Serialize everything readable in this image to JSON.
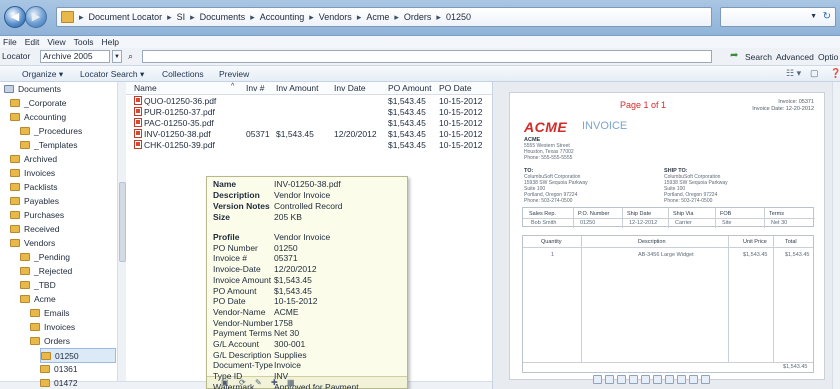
{
  "breadcrumbs": [
    "Document Locator",
    "SI",
    "Documents",
    "Accounting",
    "Vendors",
    "Acme",
    "Orders",
    "01250"
  ],
  "menu": [
    "File",
    "Edit",
    "View",
    "Tools",
    "Help"
  ],
  "locator": {
    "label": "Locator",
    "value": "Archive 2005",
    "search_label": "Search",
    "advanced_label": "Advanced",
    "options_label": "Optio"
  },
  "commands": {
    "organize": "Organize",
    "locator_search": "Locator Search",
    "collections": "Collections",
    "preview": "Preview"
  },
  "tree": [
    {
      "label": "Documents",
      "indent": 0,
      "kind": "docs"
    },
    {
      "label": "_Corporate",
      "indent": 1
    },
    {
      "label": "Accounting",
      "indent": 1
    },
    {
      "label": "_Procedures",
      "indent": 2
    },
    {
      "label": "_Templates",
      "indent": 2
    },
    {
      "label": "Archived",
      "indent": 1
    },
    {
      "label": "Invoices",
      "indent": 1
    },
    {
      "label": "Packlists",
      "indent": 1
    },
    {
      "label": "Payables",
      "indent": 1
    },
    {
      "label": "Purchases",
      "indent": 1
    },
    {
      "label": "Received",
      "indent": 1
    },
    {
      "label": "Vendors",
      "indent": 1
    },
    {
      "label": "_Pending",
      "indent": 2
    },
    {
      "label": "_Rejected",
      "indent": 2
    },
    {
      "label": "_TBD",
      "indent": 2
    },
    {
      "label": "Acme",
      "indent": 2
    },
    {
      "label": "Emails",
      "indent": 3
    },
    {
      "label": "Invoices",
      "indent": 3
    },
    {
      "label": "Orders",
      "indent": 3
    },
    {
      "label": "01250",
      "indent": 4,
      "selected": true
    },
    {
      "label": "01361",
      "indent": 4
    },
    {
      "label": "01472",
      "indent": 4
    }
  ],
  "columns": [
    "Name",
    "Inv #",
    "Inv Amount",
    "Inv Date",
    "PO Amount",
    "PO Date"
  ],
  "files": [
    {
      "name": "QUO-01250-36.pdf",
      "inv_no": "",
      "inv_amount": "",
      "inv_date": "",
      "po_amount": "$1,543.45",
      "po_date": "10-15-2012"
    },
    {
      "name": "PUR-01250-37.pdf",
      "inv_no": "",
      "inv_amount": "",
      "inv_date": "",
      "po_amount": "$1,543.45",
      "po_date": "10-15-2012"
    },
    {
      "name": "PAC-01250-35.pdf",
      "inv_no": "",
      "inv_amount": "",
      "inv_date": "",
      "po_amount": "$1,543.45",
      "po_date": "10-15-2012"
    },
    {
      "name": "INV-01250-38.pdf",
      "inv_no": "05371",
      "inv_amount": "$1,543.45",
      "inv_date": "12/20/2012",
      "po_amount": "$1,543.45",
      "po_date": "10-15-2012"
    },
    {
      "name": "CHK-01250-39.pdf",
      "inv_no": "",
      "inv_amount": "",
      "inv_date": "",
      "po_amount": "$1,543.45",
      "po_date": "10-15-2012"
    }
  ],
  "tooltip": {
    "top": [
      {
        "k": "Name",
        "v": "INV-01250-38.pdf"
      },
      {
        "k": "Description",
        "v": "Vendor Invoice"
      },
      {
        "k": "Version Notes",
        "v": "Controlled Record"
      },
      {
        "k": "Size",
        "v": "205 KB"
      }
    ],
    "profile": [
      {
        "k": "Profile",
        "v": "Vendor Invoice",
        "bold": true
      },
      {
        "k": "PO Number",
        "v": "01250"
      },
      {
        "k": "Invoice #",
        "v": "05371"
      },
      {
        "k": "Invoice-Date",
        "v": "12/20/2012"
      },
      {
        "k": "Invoice Amount",
        "v": "$1,543.45"
      },
      {
        "k": "PO Amount",
        "v": "$1,543.45"
      },
      {
        "k": "PO Date",
        "v": "10-15-2012"
      },
      {
        "k": "Vendor-Name",
        "v": "ACME"
      },
      {
        "k": "Vendor-Number",
        "v": "1758"
      },
      {
        "k": "Payment Terms",
        "v": "Net 30"
      },
      {
        "k": "G/L Account",
        "v": "300-001"
      },
      {
        "k": "G/L Description",
        "v": "Supplies"
      },
      {
        "k": "Document-Type",
        "v": "Invoice"
      },
      {
        "k": "Type ID",
        "v": "INV"
      },
      {
        "k": "Watermark",
        "v": "Approved for Payment"
      }
    ]
  },
  "preview_doc": {
    "brand": "ACME",
    "title": "INVOICE",
    "page_label": "Page 1 of 1",
    "invoice_no": "Invoice: 05371",
    "invoice_date": "Invoice Date: 12-20-2012",
    "from_name": "ACME",
    "from_lines": [
      "5555 Western Street",
      "Houston, Texas 77002",
      "Phone: 555-555-5555"
    ],
    "to_label": "TO:",
    "to_lines": [
      "ColumbuSoft Corporation",
      "15938 SW Sequoia Parkway",
      "Suite 100",
      "Portland, Oregon 97224",
      "Phone: 503-274-0500"
    ],
    "shipto_label": "SHIP TO:",
    "shipto_lines": [
      "ColumbuSoft Corporation",
      "15938 SW Sequoia Parkway",
      "Suite 100",
      "Portland, Oregon 97224",
      "Phone: 503-274-0500"
    ],
    "ship_headers": [
      "Sales Rep.",
      "P.O. Number",
      "Ship Date",
      "Ship Via",
      "FOB",
      "Terms"
    ],
    "ship_values": [
      "Bob Smith",
      "01250",
      "12-12-2012",
      "Carrier",
      "Site",
      "Net 30"
    ],
    "item_headers": [
      "Quantity",
      "Description",
      "Unit Price",
      "Total"
    ],
    "item_values": [
      "1",
      "AB-3456 Large Widget",
      "$1,543.45",
      "$1,543.45"
    ],
    "total": "$1,543.45"
  }
}
